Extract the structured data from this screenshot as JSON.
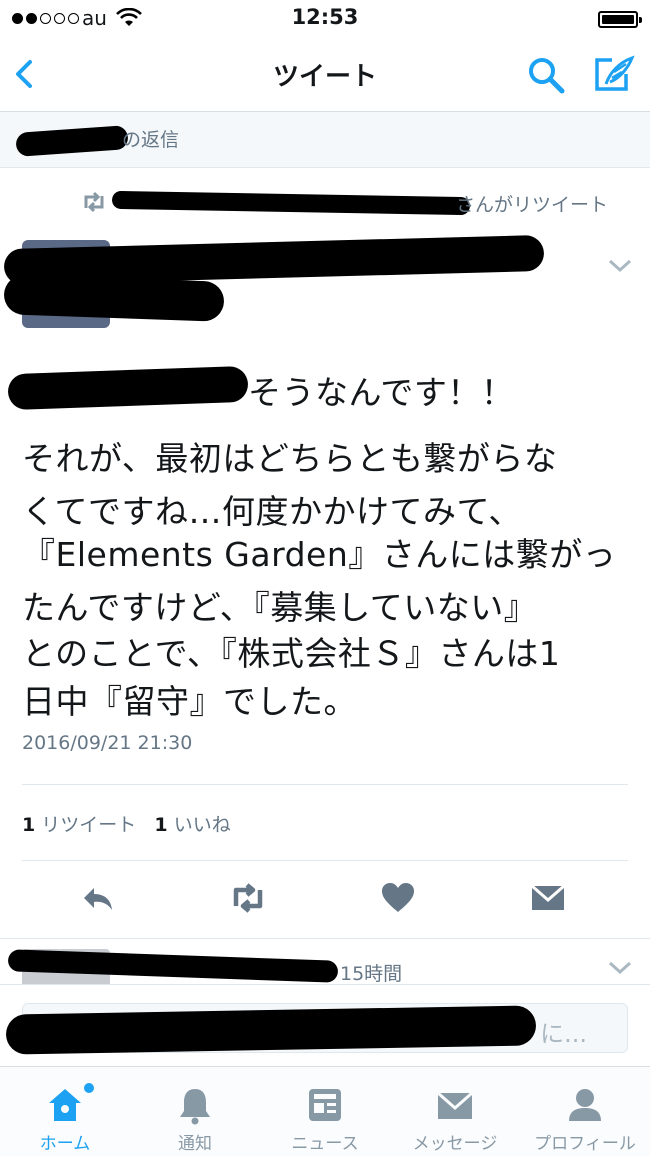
{
  "status_bar": {
    "carrier": "au",
    "time": "12:53"
  },
  "nav": {
    "title": "ツイート"
  },
  "reply_context": {
    "text": "の返信"
  },
  "retweet": {
    "label": "さんがリツイート"
  },
  "tweet": {
    "lines": [
      "そうなんです！！",
      "それが、最初はどちらとも繋がらな",
      "くてですね…何度かかけてみて、",
      "『Elements Garden』さんには繋がっ",
      "たんですけど、『募集していない』",
      "とのことで、『株式会社Ｓ』さんは1",
      "日中『留守』でした。"
    ],
    "timestamp": "2016/09/21 21:30",
    "retweet_count": "1",
    "retweet_label": "リツイート",
    "like_count": "1",
    "like_label": "いいね"
  },
  "reply_item": {
    "time": "15時間"
  },
  "composer": {
    "placeholder": "に..."
  },
  "tabs": [
    {
      "label": "ホーム",
      "icon": "home-icon",
      "active": true
    },
    {
      "label": "通知",
      "icon": "bell-icon",
      "active": false
    },
    {
      "label": "ニュース",
      "icon": "news-icon",
      "active": false
    },
    {
      "label": "メッセージ",
      "icon": "envelope-icon",
      "active": false
    },
    {
      "label": "プロフィール",
      "icon": "person-icon",
      "active": false
    }
  ],
  "colors": {
    "accent": "#1da1f2",
    "icon_gray": "#657786",
    "text_muted": "#657786"
  }
}
